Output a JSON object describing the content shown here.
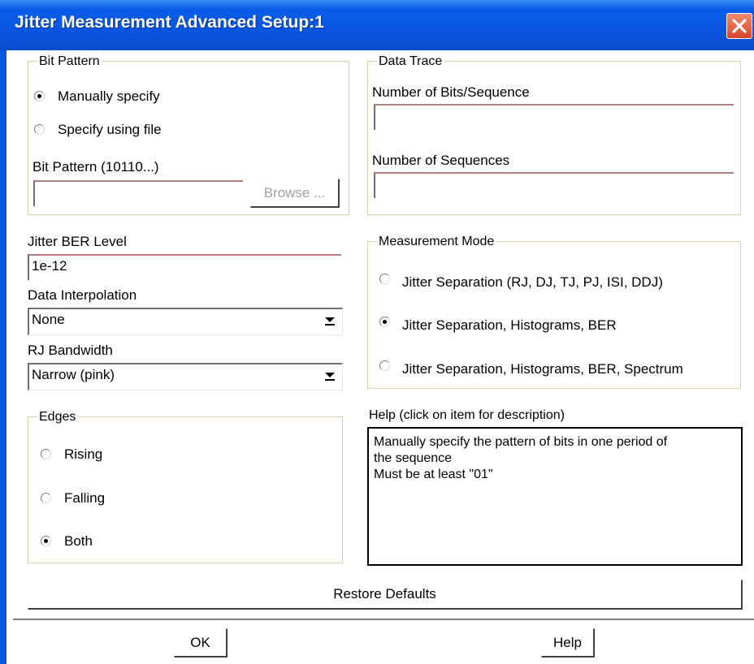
{
  "window": {
    "title": "Jitter Measurement Advanced Setup:1"
  },
  "bit_pattern": {
    "group_label": "Bit Pattern",
    "radio_manual": "Manually specify",
    "radio_file": "Specify using file",
    "selected": "manual",
    "pattern_label": "Bit Pattern (10110...)",
    "pattern_value": "",
    "browse_label": "Browse ..."
  },
  "data_trace": {
    "group_label": "Data Trace",
    "bits_label": "Number of Bits/Sequence",
    "bits_value": "",
    "sequences_label": "Number of Sequences",
    "sequences_value": ""
  },
  "jitter_ber": {
    "label": "Jitter BER Level",
    "value": "1e-12"
  },
  "interpolation": {
    "label": "Data Interpolation",
    "value": "None"
  },
  "rj_bandwidth": {
    "label": "RJ Bandwidth",
    "value": "Narrow (pink)"
  },
  "measurement_mode": {
    "group_label": "Measurement Mode",
    "options": [
      "Jitter Separation (RJ, DJ, TJ, PJ, ISI, DDJ)",
      "Jitter Separation, Histograms, BER",
      "Jitter Separation, Histograms, BER, Spectrum"
    ],
    "selected_index": 1
  },
  "edges": {
    "group_label": "Edges",
    "options": [
      "Rising",
      "Falling",
      "Both"
    ],
    "selected_index": 2
  },
  "help": {
    "label": "Help (click on item for description)",
    "lines": [
      "Manually specify the pattern of bits in one period of",
      "the sequence",
      "Must be at least \"01\""
    ]
  },
  "buttons": {
    "restore_defaults": "Restore Defaults",
    "ok": "OK",
    "help": "Help"
  },
  "colors": {
    "titlebar": "#0a55df",
    "close_button": "#d9452a",
    "group_border": "#d8d0a8"
  }
}
